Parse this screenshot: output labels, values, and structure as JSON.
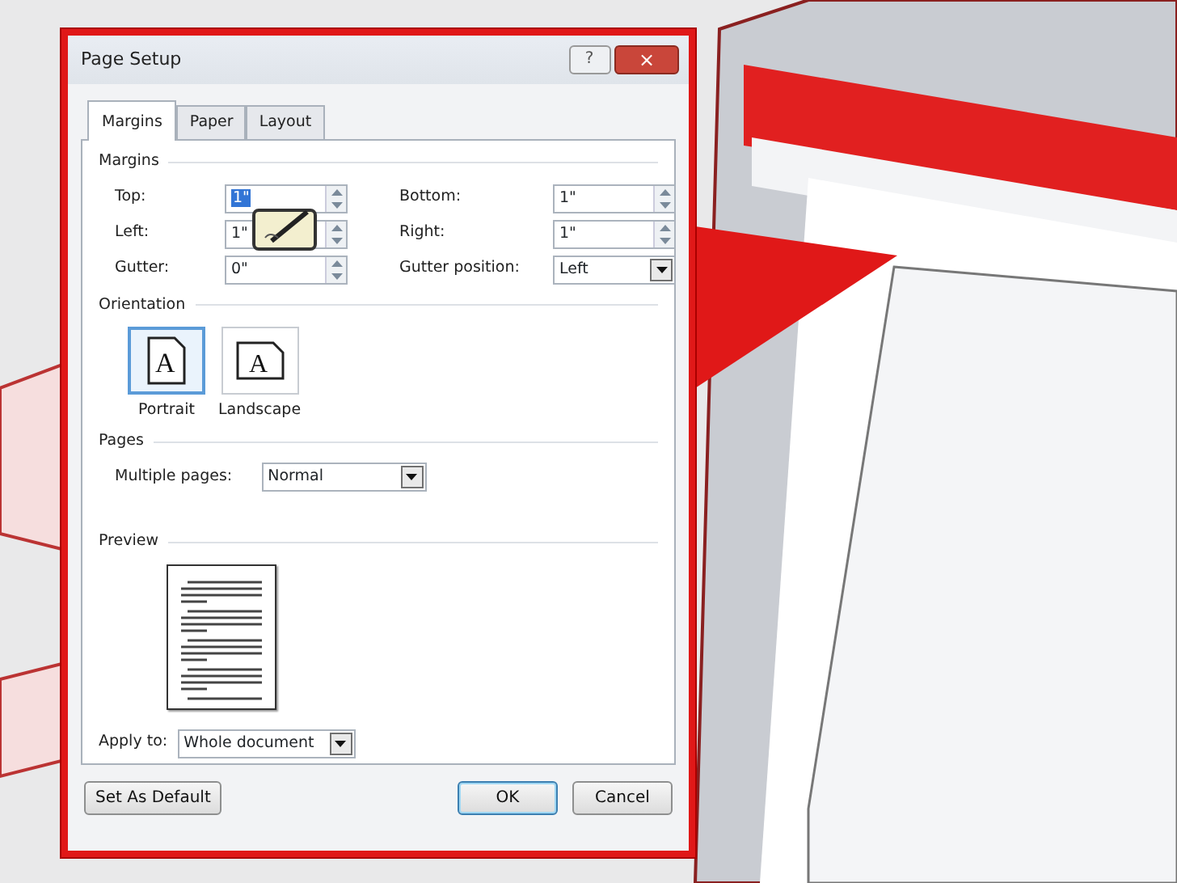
{
  "window": {
    "title": "Page Setup",
    "help_button": "?",
    "close_button": "×"
  },
  "tabs": [
    {
      "label": "Margins",
      "selected": true
    },
    {
      "label": "Paper",
      "selected": false
    },
    {
      "label": "Layout",
      "selected": false
    }
  ],
  "margins": {
    "heading": "Margins",
    "fields": [
      {
        "label": "Top:",
        "value": "1\"",
        "kind": "spinner",
        "highlighted": true
      },
      {
        "label": "Bottom:",
        "value": "1\"",
        "kind": "spinner",
        "highlighted": false
      },
      {
        "label": "Left:",
        "value": "1\"",
        "kind": "spinner",
        "highlighted": false
      },
      {
        "label": "Right:",
        "value": "1\"",
        "kind": "spinner",
        "highlighted": false
      },
      {
        "label": "Gutter:",
        "value": "0\"",
        "kind": "spinner",
        "highlighted": false
      },
      {
        "label": "Gutter position:",
        "value": "Left",
        "kind": "dropdown",
        "highlighted": false
      }
    ]
  },
  "orientation": {
    "heading": "Orientation",
    "options": [
      {
        "label": "Portrait",
        "selected": true,
        "glyph": "A"
      },
      {
        "label": "Landscape",
        "selected": false,
        "glyph": "A"
      }
    ]
  },
  "pages": {
    "heading": "Pages",
    "label": "Multiple pages:",
    "value": "Normal"
  },
  "preview": {
    "heading": "Preview",
    "apply_to_label": "Apply to:",
    "apply_to_value": "Whole document"
  },
  "buttons": [
    {
      "label": "Set As Default",
      "kind": "secondary",
      "default": false
    },
    {
      "label": "OK",
      "kind": "primary",
      "default": true
    },
    {
      "label": "Cancel",
      "kind": "primary",
      "default": false
    }
  ]
}
